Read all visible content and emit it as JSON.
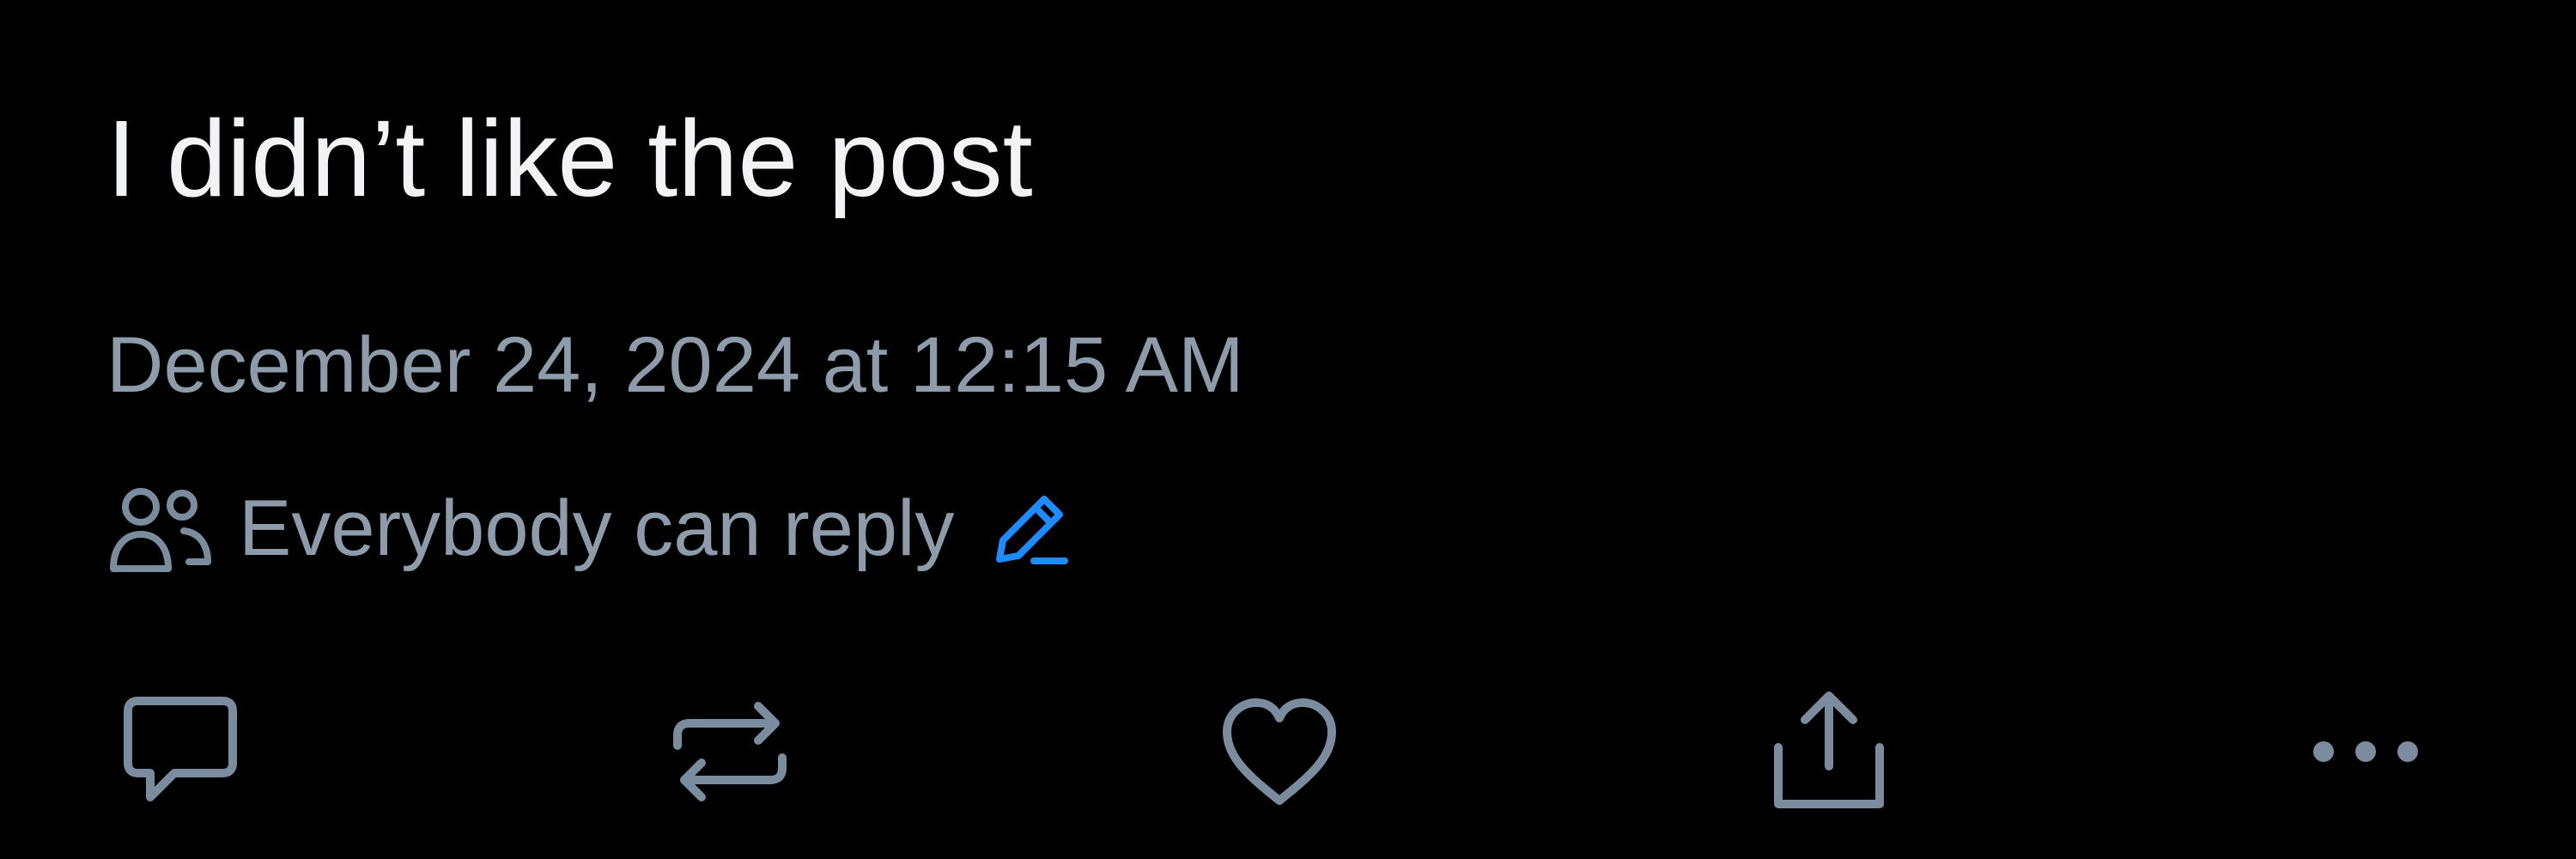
{
  "post": {
    "text": "I didn’t like the post",
    "timestamp": "December 24, 2024 at 12:15 AM",
    "reply_settings": {
      "label": "Everybody can reply",
      "icon": "people-icon",
      "edit_icon": "pencil-edit-icon"
    }
  },
  "actions": [
    {
      "name": "reply",
      "icon": "speech-bubble-icon"
    },
    {
      "name": "repost",
      "icon": "repost-arrows-icon"
    },
    {
      "name": "like",
      "icon": "heart-icon"
    },
    {
      "name": "share",
      "icon": "share-upload-icon"
    },
    {
      "name": "more",
      "icon": "ellipsis-icon"
    }
  ],
  "colors": {
    "background": "#000000",
    "primary_text": "#F1F3F5",
    "secondary_text": "#8E9BAA",
    "icon": "#7A8C9E",
    "accent": "#1E8BFF"
  }
}
